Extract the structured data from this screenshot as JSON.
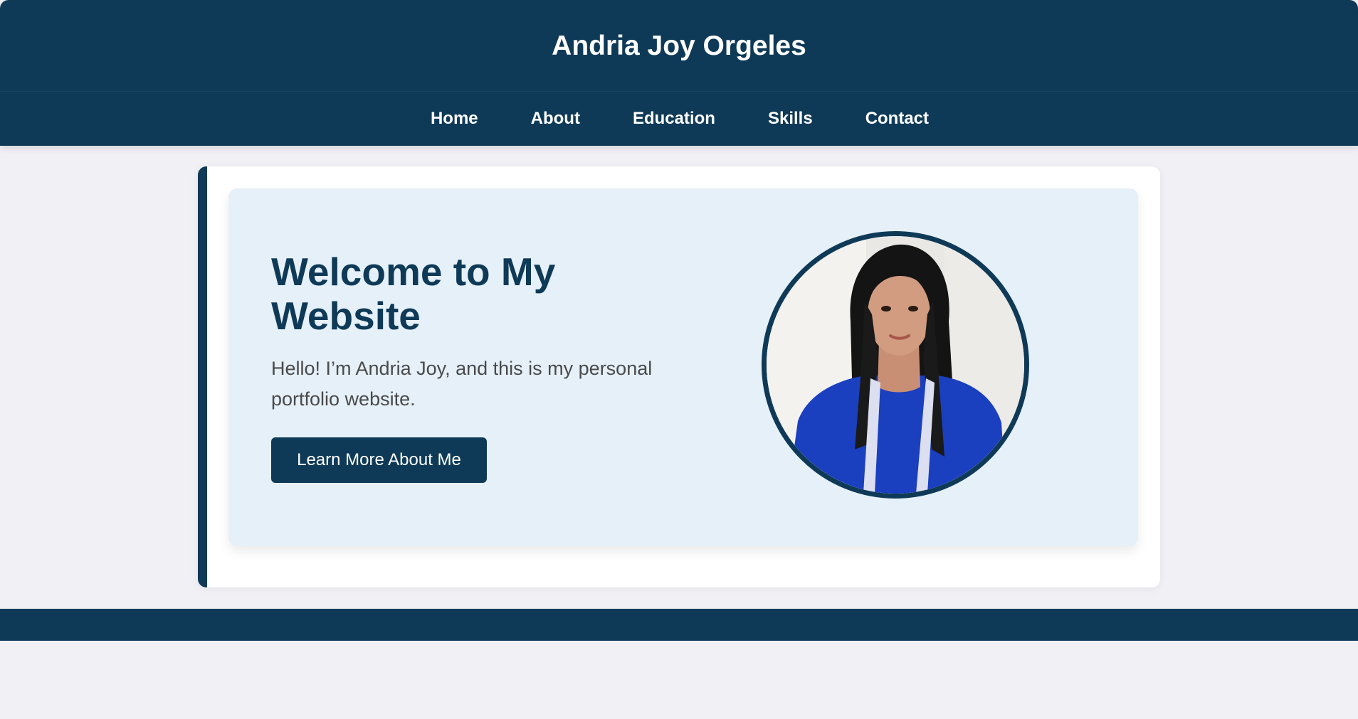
{
  "header": {
    "title": "Andria Joy Orgeles"
  },
  "nav": {
    "items": [
      {
        "label": "Home"
      },
      {
        "label": "About"
      },
      {
        "label": "Education"
      },
      {
        "label": "Skills"
      },
      {
        "label": "Contact"
      }
    ]
  },
  "hero": {
    "title": "Welcome to My Website",
    "text": "Hello! I’m Andria Joy, and this is my personal portfolio website.",
    "button_label": "Learn More About Me",
    "image_alt": "profile photo"
  },
  "colors": {
    "primary": "#0f3a57",
    "hero_background": "#e5f0f8",
    "page_background": "#f0f0f5",
    "card_background": "#ffffff"
  }
}
